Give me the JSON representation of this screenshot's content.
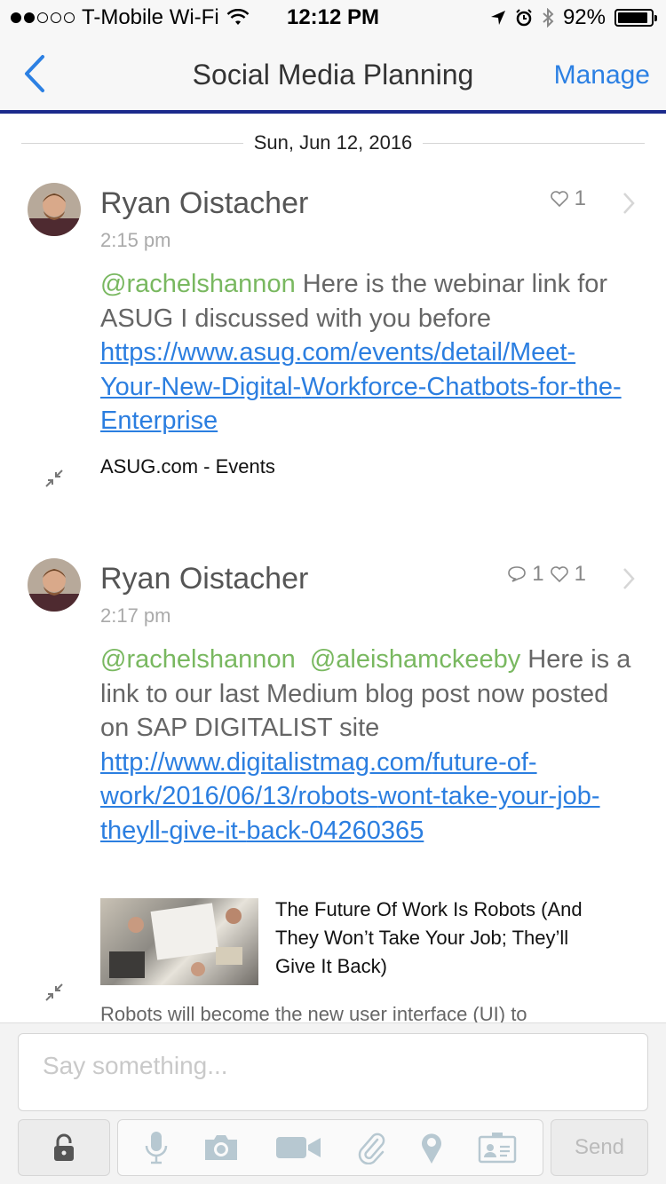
{
  "status_bar": {
    "carrier": "T-Mobile Wi-Fi",
    "time": "12:12 PM",
    "battery": "92%",
    "battery_level": 0.92
  },
  "nav": {
    "title": "Social Media Planning",
    "right_action": "Manage"
  },
  "date_separator": "Sun, Jun 12, 2016",
  "messages": [
    {
      "author": "Ryan Oistacher",
      "time": "2:15 pm",
      "likes": "1",
      "mentions": [
        "@rachelshannon"
      ],
      "text": " Here is the webinar link for ASUG I discussed with you before ",
      "link_parts": [
        "https://www.asug.com/events/",
        "detail/Meet-Your-New-Digital-",
        "Workforce-Chatbots-for-the-Enterprise"
      ],
      "preview_title": "ASUG.com - Events"
    },
    {
      "author": "Ryan Oistacher",
      "time": "2:17 pm",
      "comments": "1",
      "likes": "1",
      "mentions": [
        "@rachelshannon",
        "@aleishamckeeby"
      ],
      "text": " Here is a link to our last Medium blog post now posted on SAP DIGITALIST site ",
      "link_parts": [
        "http://www.digitalistmag.com/",
        "future-of-work/2016/06/13/robots-",
        "wont-take-your-job-theyll-give-it-",
        "back-04260365"
      ],
      "preview_title": "The Future Of Work Is Robots (And They Won’t Take Your Job; They’ll Give It Back)",
      "preview_snippet": "Robots will become the new user interface (UI) to"
    }
  ],
  "composer": {
    "placeholder": "Say something...",
    "send_label": "Send"
  },
  "colors": {
    "accent": "#2c80e3",
    "mention": "#79b860",
    "nav_border": "#1b2a8c"
  },
  "icons": [
    "back-chevron-icon",
    "wifi-icon",
    "location-icon",
    "alarm-icon",
    "bluetooth-icon",
    "heart-icon",
    "comment-icon",
    "chevron-right-icon",
    "collapse-icon",
    "lock-icon",
    "microphone-icon",
    "camera-icon",
    "video-icon",
    "paperclip-icon",
    "location-pin-icon",
    "contact-card-icon"
  ]
}
